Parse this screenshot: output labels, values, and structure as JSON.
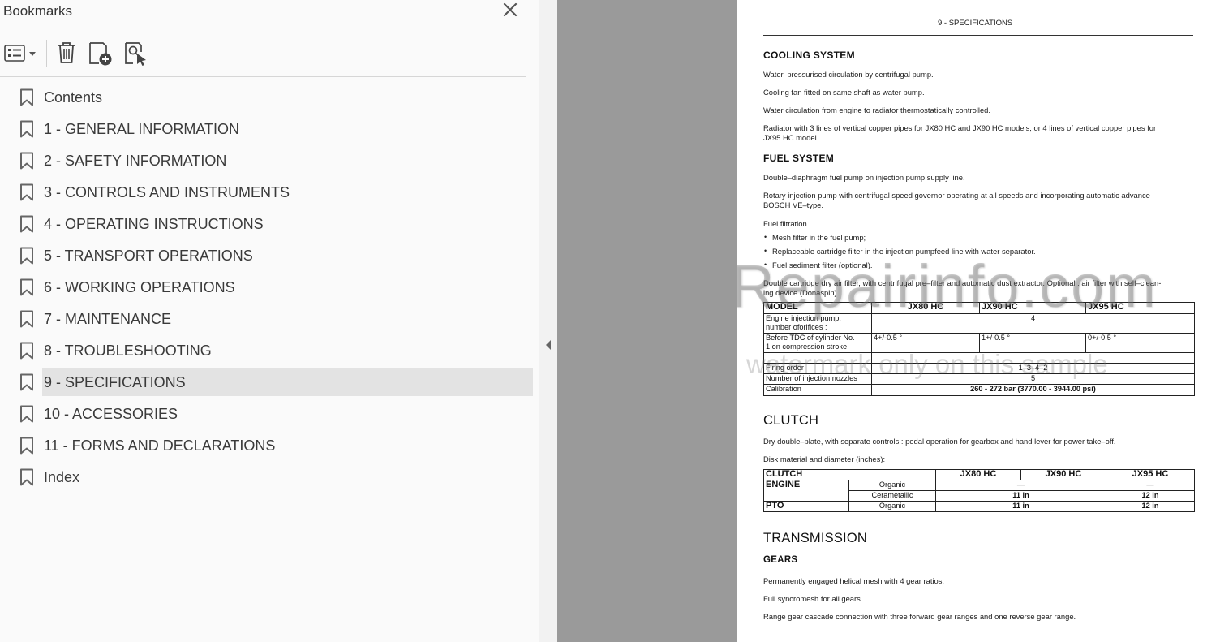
{
  "bookmarks": {
    "title": "Bookmarks",
    "items": [
      {
        "label": "Contents"
      },
      {
        "label": "1 - GENERAL INFORMATION"
      },
      {
        "label": "2 - SAFETY INFORMATION"
      },
      {
        "label": "3 - CONTROLS AND INSTRUMENTS"
      },
      {
        "label": "4 - OPERATING INSTRUCTIONS"
      },
      {
        "label": "5 - TRANSPORT OPERATIONS"
      },
      {
        "label": "6 - WORKING OPERATIONS"
      },
      {
        "label": "7 - MAINTENANCE"
      },
      {
        "label": "8 - TROUBLESHOOTING"
      },
      {
        "label": "9 - SPECIFICATIONS",
        "selected": true
      },
      {
        "label": "10 - ACCESSORIES"
      },
      {
        "label": "11 - FORMS AND DECLARATIONS"
      },
      {
        "label": "Index"
      }
    ]
  },
  "icons": {
    "close": "close-icon",
    "options": "list-options-icon",
    "delete": "trash-icon",
    "add": "add-bookmark-icon",
    "find": "find-bookmark-icon",
    "bookmark": "bookmark-icon",
    "collapse": "collapse-arrow-icon"
  },
  "document": {
    "header": "9 - SPECIFICATIONS",
    "cooling": {
      "heading": "COOLING SYSTEM",
      "lines": [
        "Water, pressurised circulation by centrifugal pump.",
        "Cooling fan fitted on same shaft as water pump.",
        "Water circulation from engine to radiator thermostatically controlled.",
        "Radiator with 3 lines of vertical copper pipes for JX80 HC and JX90 HC models, or 4 lines of vertical copper pipes for",
        "JX95 HC model."
      ]
    },
    "fuel": {
      "heading": "FUEL SYSTEM",
      "line1": "Double–diaphragm fuel pump on injection pump supply line.",
      "line2a": "Rotary injection pump with centrifugal speed governor operating at all speeds and incorporating automatic advance",
      "line2b": "BOSCH VE–type.",
      "filtration": "Fuel filtration :",
      "bullets": [
        "Mesh filter in the fuel pump;",
        "Replaceable cartridge filter in the injection pumpfeed line with water separator.",
        "Fuel sediment filter (optional)."
      ],
      "air1": "Double cartridge dry air filter, with centrifugal pre–filter and automatic dust extractor. Optional : air filter with self–clean-",
      "air2": "ing device (Donaspin).",
      "table": {
        "h0": "MODEL",
        "h1": "JX80 HC",
        "h2": "JX90 HC",
        "h3": "JX95 HC",
        "r1a": "Engine injection pump,",
        "r1b": "number oforifices :",
        "r1v": "4",
        "r2a": "Before TDC of cylinder No.",
        "r2b": "1 on compression stroke",
        "r2v1": "4+/-0.5 °",
        "r2v2": "1+/-0.5 °",
        "r2v3": "0+/-0.5 °",
        "r4a": "Firing order",
        "r4v": "1–3–4–2",
        "r5a": "Number of injection nozzles",
        "r5v": "5",
        "r6a": "Calibration",
        "r6v": "260 - 272 bar (3770.00 - 3944.00 psi)"
      }
    },
    "clutch": {
      "heading": "CLUTCH",
      "line1": "Dry double–plate, with separate controls : pedal operation for gearbox and hand lever for power take–off.",
      "line2": "Disk material and diameter (inches):",
      "table": {
        "h0": "CLUTCH",
        "h1": "JX80 HC",
        "h2": "JX90 HC",
        "h3": "JX95 HC",
        "engine": "ENGINE",
        "organic": "Organic",
        "dash": "—",
        "cerametallic": "Cerametallic",
        "v11": "11 in",
        "v12": "12 in",
        "pto": "PTO",
        "organic2": "Organic",
        "v11b": "11 in",
        "v12b": "12 in"
      }
    },
    "transmission": {
      "heading": "TRANSMISSION",
      "sub": "GEARS",
      "lines": [
        "Permanently engaged helical mesh with 4 gear ratios.",
        "Full syncromesh for all gears.",
        "Range gear cascade connection with three forward gear ranges and one reverse gear range."
      ]
    },
    "watermark1": "eRepairinfo.com",
    "watermark2": "watermark only on this sample"
  }
}
